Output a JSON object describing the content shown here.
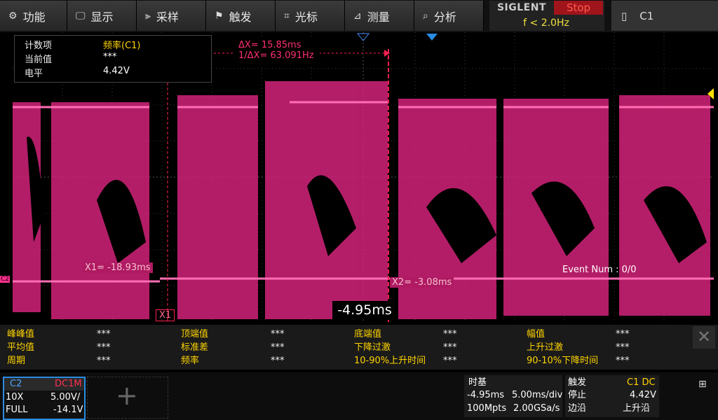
{
  "menu": [
    {
      "icon": "function-icon",
      "glyph": "⚙",
      "label": "功能"
    },
    {
      "icon": "display-icon",
      "glyph": "🖵",
      "label": "显示"
    },
    {
      "icon": "acquire-icon",
      "glyph": "⫸",
      "label": "采样"
    },
    {
      "icon": "trigger-icon",
      "glyph": "⚑",
      "label": "触发"
    },
    {
      "icon": "cursor-icon",
      "glyph": "⌗",
      "label": "光标"
    },
    {
      "icon": "measure-icon",
      "glyph": "⊿",
      "label": "测量"
    },
    {
      "icon": "analyze-icon",
      "glyph": "⌕",
      "label": "分析"
    }
  ],
  "brand": {
    "name": "SIGLENT",
    "run_state": "Stop",
    "trigger_freq": "f < 2.0Hz"
  },
  "channel_indicator": "C1",
  "counter": {
    "item_label": "计数项",
    "item_value": "频率(C1)",
    "current_label": "当前值",
    "current_value": "***",
    "level_label": "电平",
    "level_value": "4.42V"
  },
  "cursors": {
    "delta_x": "ΔX= 15.85ms",
    "inv_delta_x": "1/ΔX= 63.091Hz",
    "x1": "X1= -18.93ms",
    "x2": "X2= -3.08ms",
    "x1_tag": "X1"
  },
  "delay_readout": "-4.95ms",
  "event_num": "Event Num : 0/0",
  "measurements": [
    {
      "label": "峰峰值",
      "value": "***"
    },
    {
      "label": "顶端值",
      "value": "***"
    },
    {
      "label": "底端值",
      "value": "***"
    },
    {
      "label": "幅值",
      "value": "***"
    },
    {
      "label": "平均值",
      "value": "***"
    },
    {
      "label": "标准差",
      "value": "***"
    },
    {
      "label": "下降过激",
      "value": "***"
    },
    {
      "label": "上升过激",
      "value": "***"
    },
    {
      "label": "周期",
      "value": "***"
    },
    {
      "label": "频率",
      "value": "***"
    },
    {
      "label": "10-90%上升时间",
      "value": "***"
    },
    {
      "label": "90-10%下降时间",
      "value": "***"
    }
  ],
  "channel2": {
    "name": "C2",
    "coupling": "DC1M",
    "probe": "10X",
    "scale": "5.00V/",
    "bandwidth": "FULL",
    "offset": "-14.1V"
  },
  "timebase": {
    "title": "时基",
    "delay": "-4.95ms",
    "scale": "5.00ms/div",
    "memory": "100Mpts",
    "sample_rate": "2.00GSa/s"
  },
  "trigger": {
    "title": "触发",
    "source": "C1 DC",
    "state": "停止",
    "level": "4.42V",
    "edge_label": "边沿",
    "slope": "上升沿"
  },
  "colors": {
    "trace": "#ff2f8e",
    "cursor": "#ff2050",
    "menu_accent": "#ffd400"
  }
}
